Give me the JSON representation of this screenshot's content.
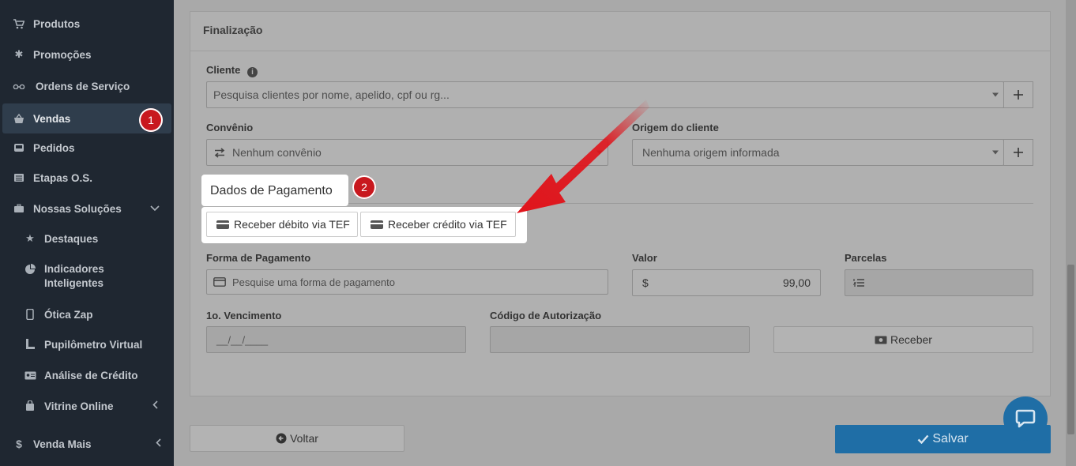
{
  "sidebar": {
    "items": [
      {
        "label": "Produtos",
        "icon": "cart-icon"
      },
      {
        "label": "Promoções",
        "icon": "asterisk-icon"
      },
      {
        "label": "Ordens de Serviço",
        "icon": "glasses-icon"
      },
      {
        "label": "Vendas",
        "icon": "basket-icon"
      },
      {
        "label": "Pedidos",
        "icon": "inbox-icon"
      },
      {
        "label": "Etapas O.S.",
        "icon": "list-icon"
      },
      {
        "label": "Nossas Soluções",
        "icon": "briefcase-icon"
      },
      {
        "label": "Destaques",
        "icon": "star-icon"
      },
      {
        "label": "Indicadores Inteligentes",
        "icon": "pie-chart-icon"
      },
      {
        "label": "Ótica Zap",
        "icon": "mobile-icon"
      },
      {
        "label": "Pupilômetro Virtual",
        "icon": "ruler-icon"
      },
      {
        "label": "Análise de Crédito",
        "icon": "id-card-icon"
      },
      {
        "label": "Vitrine Online",
        "icon": "bag-icon"
      },
      {
        "label": "Venda Mais",
        "icon": "dollar-icon"
      }
    ],
    "badge": "1"
  },
  "card": {
    "title": "Finalização"
  },
  "cliente": {
    "label": "Cliente",
    "placeholder": "Pesquisa clientes por nome, apelido, cpf ou rg..."
  },
  "convenio": {
    "label": "Convênio",
    "value": "Nenhum convênio"
  },
  "origem": {
    "label": "Origem do cliente",
    "value": "Nenhuma origem informada"
  },
  "pagamento": {
    "title": "Dados de Pagamento",
    "badge": "2",
    "debito_label": "Receber débito via TEF",
    "credito_label": "Receber crédito via TEF"
  },
  "forma": {
    "label": "Forma de Pagamento",
    "placeholder": "Pesquise uma forma de pagamento"
  },
  "valor": {
    "label": "Valor",
    "currency": "$",
    "value": "99,00"
  },
  "parcelas": {
    "label": "Parcelas"
  },
  "vencimento": {
    "label": "1o. Vencimento",
    "placeholder": "__/__/____"
  },
  "autorizacao": {
    "label": "Código de Autorização"
  },
  "actions": {
    "receber": "Receber",
    "voltar": "Voltar",
    "salvar": "Salvar"
  },
  "colors": {
    "accent": "#1f6ea6",
    "badge": "#c8181e",
    "arrow": "#e0141b",
    "sidebar_bg": "#1f2731"
  }
}
